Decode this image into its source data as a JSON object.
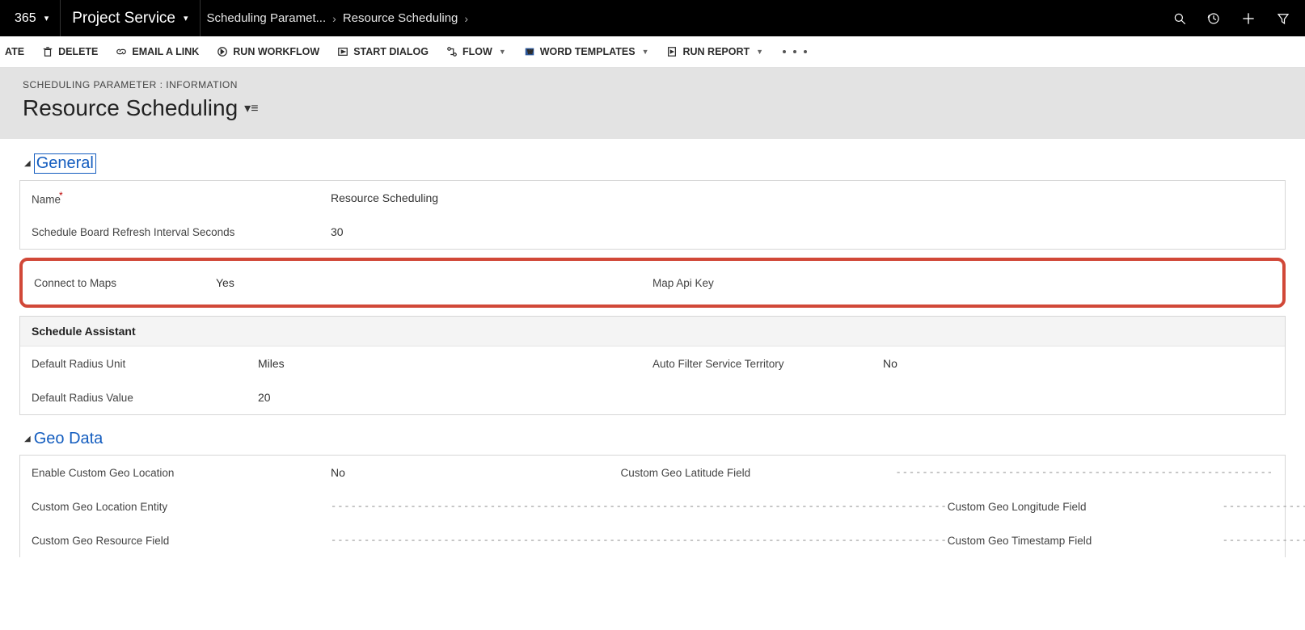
{
  "topnav": {
    "brand": "365",
    "app": "Project Service",
    "breadcrumb": [
      "Scheduling Paramet...",
      "Resource Scheduling"
    ]
  },
  "cmdbar": {
    "ate": "ATE",
    "delete": "DELETE",
    "email_link": "EMAIL A LINK",
    "run_workflow": "RUN WORKFLOW",
    "start_dialog": "START DIALOG",
    "flow": "FLOW",
    "word_templates": "WORD TEMPLATES",
    "run_report": "RUN REPORT"
  },
  "header": {
    "subtitle": "SCHEDULING PARAMETER : INFORMATION",
    "title": "Resource Scheduling"
  },
  "sections": {
    "general": {
      "title": "General",
      "name_label": "Name",
      "name_value": "Resource Scheduling",
      "refresh_label": "Schedule Board Refresh Interval Seconds",
      "refresh_value": "30"
    },
    "maps": {
      "connect_label": "Connect to Maps",
      "connect_value": "Yes",
      "apikey_label": "Map Api Key",
      "apikey_value": ""
    },
    "schedule_assistant": {
      "title": "Schedule Assistant",
      "radius_unit_label": "Default Radius Unit",
      "radius_unit_value": "Miles",
      "auto_filter_label": "Auto Filter Service Territory",
      "auto_filter_value": "No",
      "radius_value_label": "Default Radius Value",
      "radius_value_value": "20"
    },
    "geo": {
      "title": "Geo Data",
      "rows": [
        {
          "l_label": "Enable Custom Geo Location",
          "l_value": "No",
          "r_label": "Custom Geo Latitude Field",
          "r_value": "---------------------------------------------------------"
        },
        {
          "l_label": "Custom Geo Location Entity",
          "l_value": "---------------------------------------------------------------------------------------------",
          "r_label": "Custom Geo Longitude Field",
          "r_value": "---------------------------------------------------------"
        },
        {
          "l_label": "Custom Geo Resource Field",
          "l_value": "---------------------------------------------------------------------------------------------",
          "r_label": "Custom Geo Timestamp Field",
          "r_value": "---------------------------------------------------------"
        }
      ]
    }
  }
}
